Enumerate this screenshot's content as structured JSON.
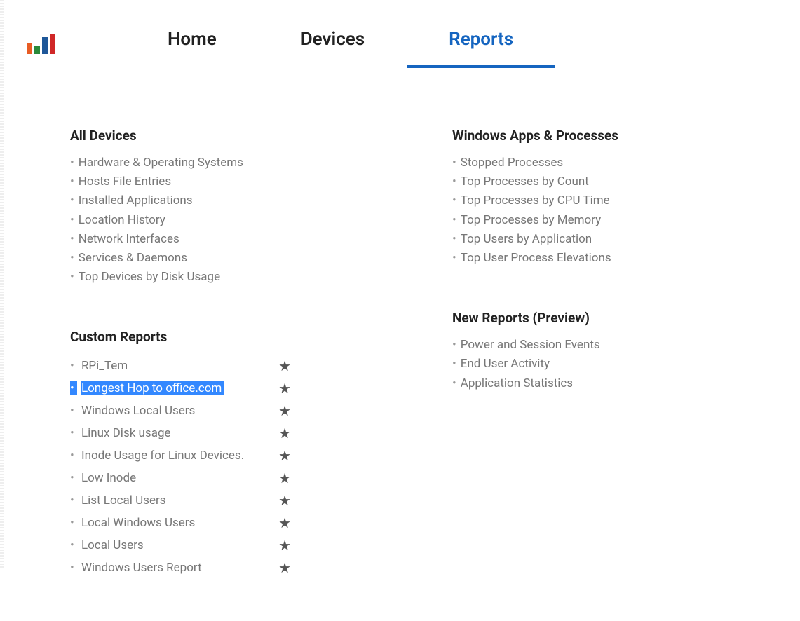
{
  "nav": {
    "home": "Home",
    "devices": "Devices",
    "reports": "Reports"
  },
  "sections": {
    "all_devices": {
      "title": "All Devices",
      "items": [
        "Hardware & Operating Systems",
        "Hosts File Entries",
        "Installed Applications",
        "Location History",
        "Network Interfaces",
        "Services & Daemons",
        "Top Devices by Disk Usage"
      ]
    },
    "windows_apps": {
      "title": "Windows Apps & Processes",
      "items": [
        "Stopped Processes",
        "Top Processes by Count",
        "Top Processes by CPU Time",
        "Top Processes by Memory",
        "Top Users by Application",
        "Top User Process Elevations"
      ]
    },
    "custom_reports": {
      "title": "Custom Reports",
      "items": [
        "RPi_Tem",
        "Longest Hop to office.com",
        "Windows Local Users",
        "Linux Disk usage",
        "Inode Usage for Linux Devices.",
        "Low Inode",
        "List Local Users",
        "Local Windows Users",
        "Local Users",
        "Windows Users Report"
      ],
      "selected_index": 1
    },
    "new_reports": {
      "title": "New Reports (Preview)",
      "items": [
        "Power and Session Events",
        "End User Activity",
        "Application Statistics"
      ]
    }
  },
  "icons": {
    "star": "★",
    "bullet": "•"
  }
}
